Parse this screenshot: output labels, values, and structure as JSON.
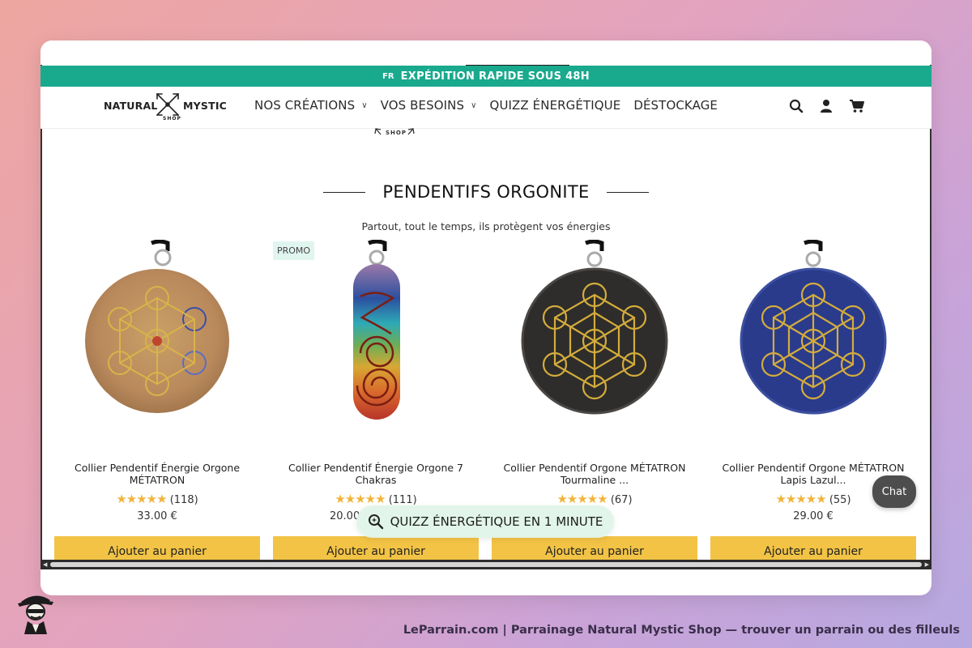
{
  "banner": {
    "flag": "FR",
    "message": "EXPÉDITION RAPIDE SOUS 48H"
  },
  "logo": {
    "left_word": "NATURAL",
    "right_word": "MYSTIC",
    "sub": "SHOP"
  },
  "nav": [
    {
      "label": "NOS CRÉATIONS",
      "has_dropdown": true
    },
    {
      "label": "VOS BESOINS",
      "has_dropdown": true
    },
    {
      "label": "QUIZZ ÉNERGÉTIQUE",
      "has_dropdown": false
    },
    {
      "label": "DÉSTOCKAGE",
      "has_dropdown": false
    }
  ],
  "header_icons": [
    "search-icon",
    "account-icon",
    "cart-icon"
  ],
  "ghost_logo_text": "SHOP",
  "section": {
    "title": "PENDENTIFS ORGONITE",
    "subtitle": "Partout, tout le temps, ils protègent vos énergies"
  },
  "products": [
    {
      "name": "Collier Pendentif Énergie Orgone MÉTATRON",
      "stars": "★★★★★",
      "reviews": "(118)",
      "price": "33.00 €",
      "badge": "",
      "cart_label": "Ajouter au panier",
      "image": "gold-flake-metatron-pendant"
    },
    {
      "name": "Collier Pendentif Énergie Orgone 7 Chakras",
      "stars": "★★★★★",
      "reviews": "(111)",
      "price": "20.00",
      "badge": "PROMO",
      "cart_label": "Ajouter au panier",
      "image": "chakra-bar-pendant"
    },
    {
      "name": "Collier Pendentif Orgone MÉTATRON Tourmaline ...",
      "stars": "★★★★★",
      "reviews": "(67)",
      "price": "",
      "badge": "",
      "cart_label": "Ajouter au panier",
      "image": "black-tourmaline-metatron-pendant"
    },
    {
      "name": "Collier Pendentif Orgone MÉTATRON Lapis Lazul...",
      "stars": "★★★★★",
      "reviews": "(55)",
      "price": "29.00 €",
      "badge": "",
      "cart_label": "Ajouter au panier",
      "image": "lapis-metatron-pendant"
    }
  ],
  "quiz_pill": {
    "label": "QUIZZ ÉNERGÉTIQUE EN 1 MINUTE",
    "icon": "magic-search-icon"
  },
  "chat": {
    "label": "Chat"
  },
  "footer": {
    "caption": "LeParrain.com | Parrainage Natural Mystic Shop — trouver un parrain ou des filleuls"
  },
  "colors": {
    "banner": "#19a98d",
    "cart_button": "#f2c345",
    "stars": "#f1b43a",
    "promo_badge": "#e0f5ef",
    "chat": "#4d4d4d"
  }
}
